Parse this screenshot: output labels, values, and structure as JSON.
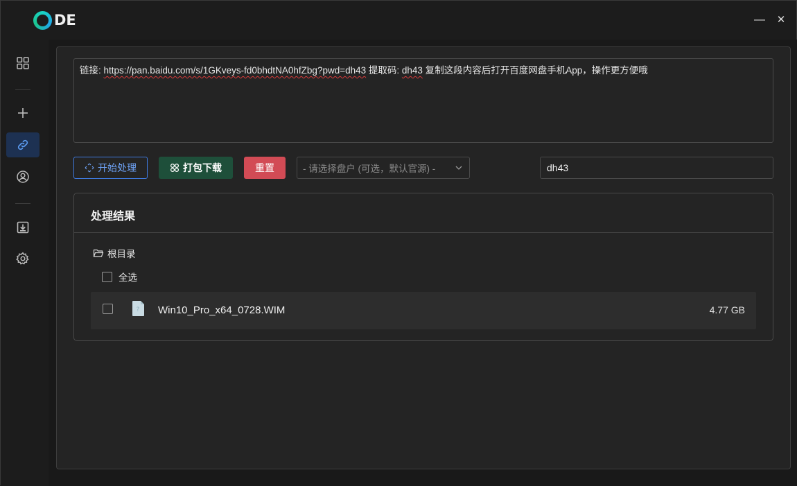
{
  "app": {
    "logo_text": "DE",
    "minimize_glyph": "—",
    "close_glyph": "✕"
  },
  "sidebar": {
    "items": [
      {
        "name": "dashboard",
        "icon": "grid-icon",
        "active": false
      },
      {
        "name": "add",
        "icon": "plus-icon",
        "active": false
      },
      {
        "name": "link",
        "icon": "link-icon",
        "active": true
      },
      {
        "name": "account",
        "icon": "user-circle-icon",
        "active": false
      },
      {
        "name": "downloads",
        "icon": "download-box-icon",
        "active": false
      },
      {
        "name": "settings",
        "icon": "gear-icon",
        "active": false
      }
    ]
  },
  "link_input": {
    "prefix": "链接: ",
    "url": "https://pan.baidu.com/s/1GKveys-fd0bhdtNA0hfZbg?pwd=dh43",
    "code_label": " 提取码: ",
    "code": "dh43",
    "suffix": " 复制这段内容后打开百度网盘手机App，操作更方便哦"
  },
  "actions": {
    "start_label": "开始处理",
    "pack_label": "打包下载",
    "reset_label": "重置",
    "disk_select_placeholder": "- 请选择盘户 (可选，默认官源) -",
    "extract_code_value": "dh43"
  },
  "result": {
    "title": "处理结果",
    "root_label": "根目录",
    "select_all_label": "全选",
    "files": [
      {
        "name": "Win10_Pro_x64_0728.WIM",
        "size": "4.77 GB",
        "icon": "unknown-file-icon"
      }
    ]
  },
  "colors": {
    "accent_blue": "#3f7be0",
    "pack_green": "#1e4f3a",
    "reset_red": "#d24b55",
    "active_sidebar": "#1d3152"
  }
}
